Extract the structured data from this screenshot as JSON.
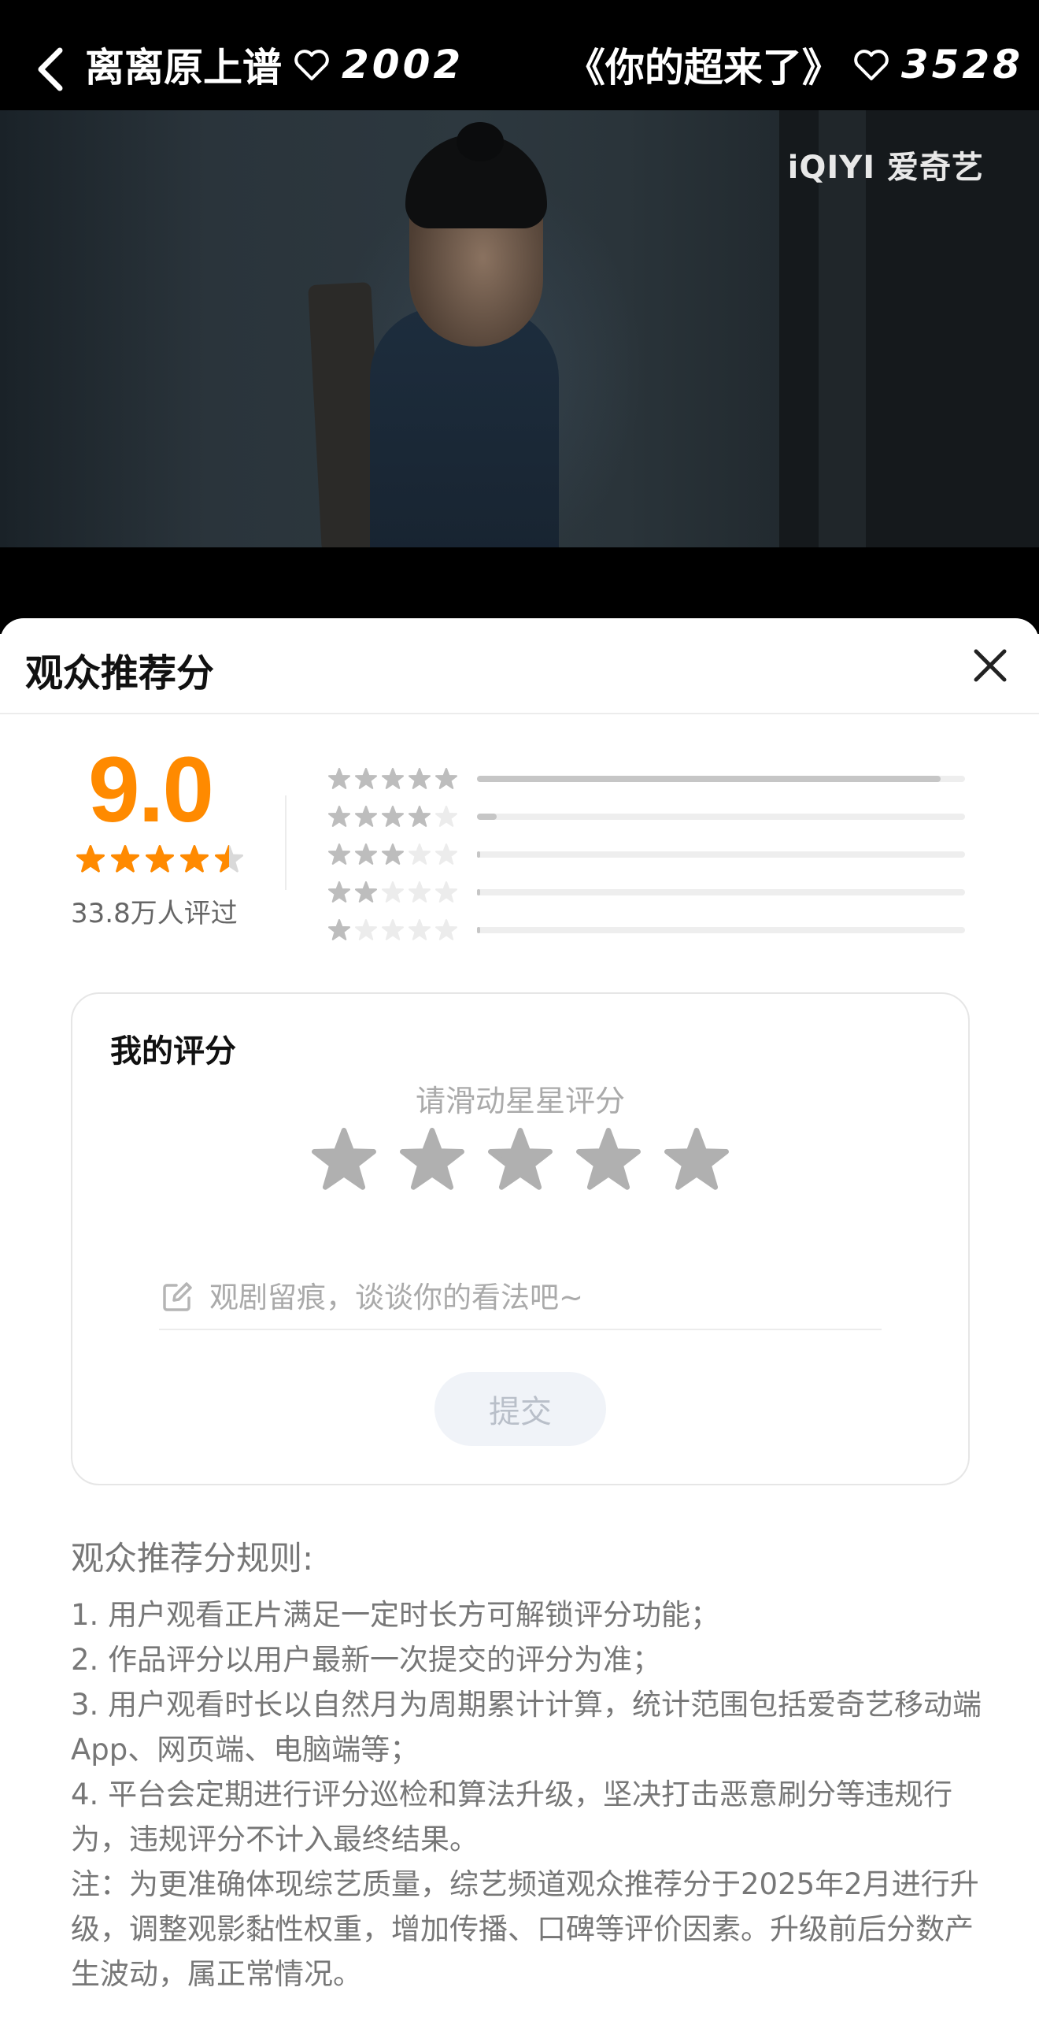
{
  "header": {
    "left_title": "离离原上谱",
    "left_likes": "2002",
    "right_title": "《你的超来了》",
    "right_likes": "3528"
  },
  "video": {
    "watermark": "iQIYI 爱奇艺"
  },
  "sheet": {
    "title": "观众推荐分"
  },
  "score": {
    "value": "9.0",
    "stars_filled": 4.5,
    "review_count": "33.8万人评过",
    "distribution": [
      {
        "stars": 5,
        "fraction": 0.95
      },
      {
        "stars": 4,
        "fraction": 0.04
      },
      {
        "stars": 3,
        "fraction": 0.005
      },
      {
        "stars": 2,
        "fraction": 0.005
      },
      {
        "stars": 1,
        "fraction": 0.005
      }
    ]
  },
  "my_rating": {
    "title": "我的评分",
    "hint": "请滑动星星评分",
    "comment_placeholder": "观剧留痕，谈谈你的看法吧~",
    "submit_label": "提交"
  },
  "rules": {
    "title": "观众推荐分规则:",
    "items": [
      "1. 用户观看正片满足一定时长方可解锁评分功能；",
      "2. 作品评分以用户最新一次提交的评分为准；",
      "3. 用户观看时长以自然月为周期累计计算，统计范围包括爱奇艺移动端App、网页端、电脑端等；",
      "4. 平台会定期进行评分巡检和算法升级，坚决打击恶意刷分等违规行为，违规评分不计入最终结果。",
      "注：为更准确体现综艺质量，综艺频道观众推荐分于2025年2月进行升级，调整观影黏性权重，增加传播、口碑等评价因素。升级前后分数产生波动，属正常情况。"
    ]
  },
  "colors": {
    "accent": "#ff8a00",
    "bar_fill": "#c6c6c6",
    "muted_text": "#777777"
  }
}
